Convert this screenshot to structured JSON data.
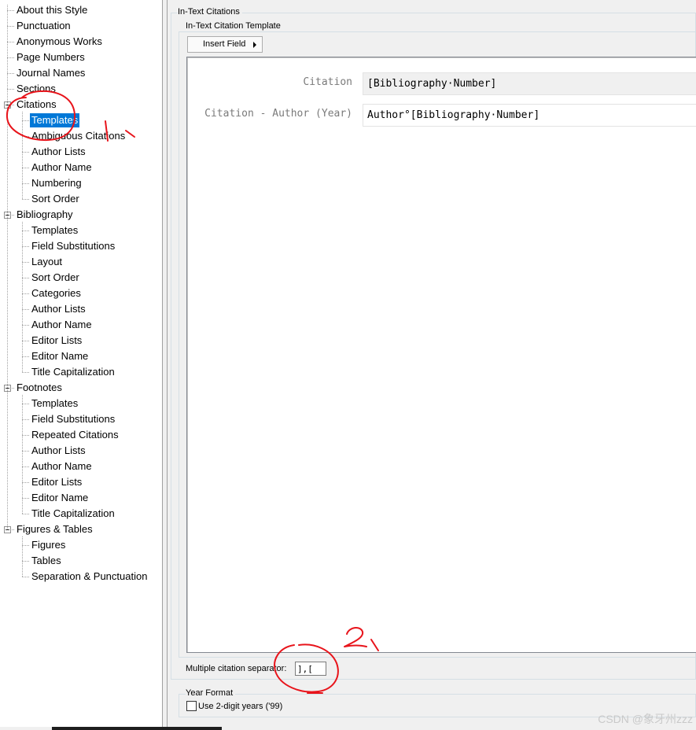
{
  "tree": {
    "items": [
      {
        "label": "About this Style"
      },
      {
        "label": "Punctuation"
      },
      {
        "label": "Anonymous Works"
      },
      {
        "label": "Page Numbers"
      },
      {
        "label": "Journal Names"
      },
      {
        "label": "Sections"
      },
      {
        "label": "Citations",
        "expanded": true,
        "children": [
          {
            "label": "Templates",
            "selected": true
          },
          {
            "label": "Ambiguous Citations"
          },
          {
            "label": "Author Lists"
          },
          {
            "label": "Author Name"
          },
          {
            "label": "Numbering"
          },
          {
            "label": "Sort Order"
          }
        ]
      },
      {
        "label": "Bibliography",
        "expanded": true,
        "children": [
          {
            "label": "Templates"
          },
          {
            "label": "Field Substitutions"
          },
          {
            "label": "Layout"
          },
          {
            "label": "Sort Order"
          },
          {
            "label": "Categories"
          },
          {
            "label": "Author Lists"
          },
          {
            "label": "Author Name"
          },
          {
            "label": "Editor Lists"
          },
          {
            "label": "Editor Name"
          },
          {
            "label": "Title Capitalization"
          }
        ]
      },
      {
        "label": "Footnotes",
        "expanded": true,
        "children": [
          {
            "label": "Templates"
          },
          {
            "label": "Field Substitutions"
          },
          {
            "label": "Repeated Citations"
          },
          {
            "label": "Author Lists"
          },
          {
            "label": "Author Name"
          },
          {
            "label": "Editor Lists"
          },
          {
            "label": "Editor Name"
          },
          {
            "label": "Title Capitalization"
          }
        ]
      },
      {
        "label": "Figures & Tables",
        "expanded": true,
        "children": [
          {
            "label": "Figures"
          },
          {
            "label": "Tables"
          },
          {
            "label": "Separation & Punctuation"
          }
        ]
      }
    ]
  },
  "panel": {
    "group_title": "In-Text Citations",
    "template_group_title": "In-Text Citation Template",
    "insert_field_label": "Insert Field",
    "templates": [
      {
        "label": "Citation",
        "value": "[Bibliography·Number]"
      },
      {
        "label": "Citation - Author (Year)",
        "value": "Author°[Bibliography·Number]"
      }
    ],
    "separator_label": "Multiple citation separator:",
    "separator_value": "],[",
    "year_format_title": "Year Format",
    "two_digit_label": "Use 2-digit years ('99)",
    "two_digit_checked": false
  },
  "colors": {
    "selection": "#0078d7",
    "annotation": "#e8141b"
  },
  "watermark": "CSDN @象牙州zzz"
}
